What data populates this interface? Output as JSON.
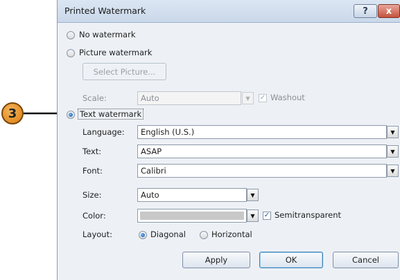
{
  "callout": {
    "step": "3"
  },
  "dialog": {
    "title": "Printed Watermark",
    "help_glyph": "?",
    "close_glyph": "x"
  },
  "options": {
    "no_watermark": "No watermark",
    "picture_watermark": "Picture watermark",
    "select_picture": "Select Picture...",
    "scale_label": "Scale:",
    "scale_value": "Auto",
    "washout": "Washout",
    "text_watermark": "Text watermark",
    "selected": "text_watermark"
  },
  "text_settings": {
    "language_label": "Language:",
    "language_value": "English (U.S.)",
    "text_label": "Text:",
    "text_value": "ASAP",
    "font_label": "Font:",
    "font_value": "Calibri",
    "size_label": "Size:",
    "size_value": "Auto",
    "color_label": "Color:",
    "color_value_hex": "#c8c8c8",
    "semitransparent": "Semitransparent",
    "semitransparent_checked": true,
    "layout_label": "Layout:",
    "diagonal": "Diagonal",
    "horizontal": "Horizontal",
    "layout_selected": "diagonal"
  },
  "buttons": {
    "apply": "Apply",
    "ok": "OK",
    "cancel": "Cancel"
  },
  "colors": {
    "accent": "#1d5fb0",
    "callout": "#e8931e"
  }
}
